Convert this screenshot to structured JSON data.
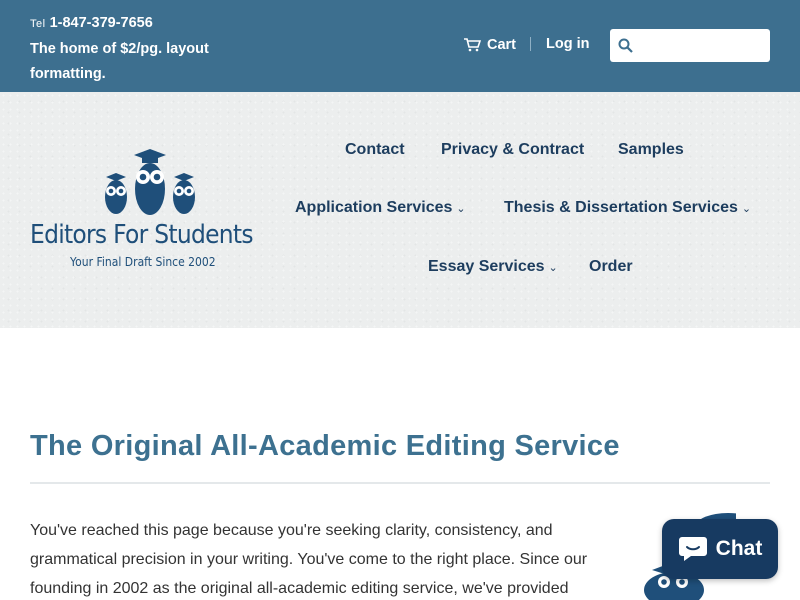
{
  "topbar": {
    "tel_prefix": "Tel",
    "phone": "1-847-379-7656",
    "tagline": "The home of $2/pg. layout formatting.",
    "cart_label": "Cart",
    "login_label": "Log in",
    "search_placeholder": ""
  },
  "logo": {
    "name": "Editors For Students",
    "tagline": "Your Final Draft Since 2002"
  },
  "nav": {
    "contact": "Contact",
    "privacy": "Privacy & Contract",
    "samples": "Samples",
    "application": "Application Services",
    "thesis": "Thesis & Dissertation Services",
    "essay": "Essay Services",
    "order": "Order",
    "caret": "⌵"
  },
  "main": {
    "heading": "The Original All-Academic Editing Service",
    "paragraph": "You've reached this page because you're seeking clarity, consistency, and grammatical precision in your writing. You've come to the right place. Since our founding in 2002 as the original all-academic editing service, we've provided"
  },
  "chat": {
    "label": "Chat"
  },
  "colors": {
    "topbar": "#3d6f8f",
    "nav_text": "#1d3d5e",
    "heading": "#3d7190",
    "chat_bg": "#173a61"
  }
}
